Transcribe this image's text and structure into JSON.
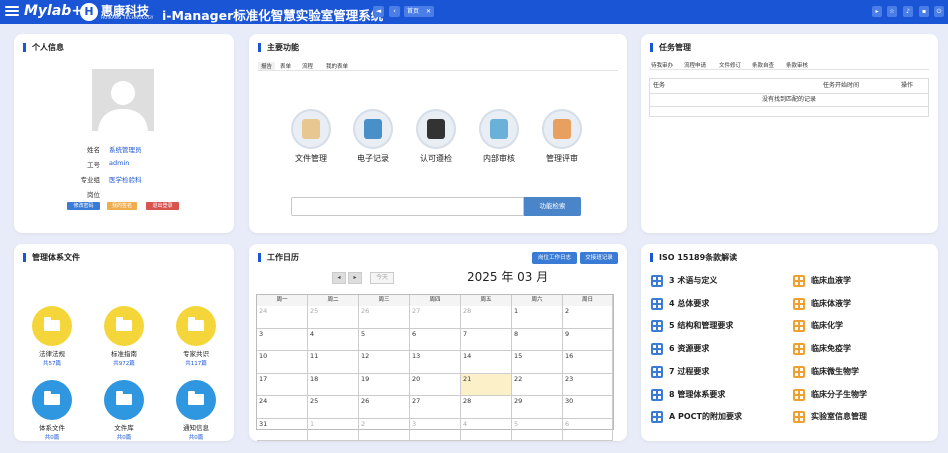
{
  "header": {
    "logo": "Mylab+",
    "company": "惠康科技",
    "company_en": "HUIKANG TECHNOLOGY",
    "system_title": "i-Manager标准化智慧实验室管理系统",
    "home_tab": "首页",
    "nav_prev": "◄",
    "nav_next": "‹",
    "tab_close": "✕"
  },
  "profile": {
    "title": "个人信息",
    "fields": [
      {
        "label": "姓名",
        "value": "系统管理员"
      },
      {
        "label": "工号",
        "value": "admin"
      },
      {
        "label": "专业组",
        "value": "医学检验科"
      },
      {
        "label": "岗位",
        "value": ""
      }
    ],
    "buttons": [
      "修改密码",
      "我的签名",
      "退出登录"
    ],
    "button_colors": [
      "#3a7bd5",
      "#f0ad4e",
      "#d9534f"
    ]
  },
  "functions": {
    "title": "主要功能",
    "tabs": [
      "报告",
      "表单",
      "流程",
      "我的表单"
    ],
    "items": [
      {
        "label": "文件管理",
        "icon": "document-management-icon"
      },
      {
        "label": "电子记录",
        "icon": "electronic-record-icon"
      },
      {
        "label": "认可遵检",
        "icon": "accreditation-icon"
      },
      {
        "label": "内部审核",
        "icon": "internal-audit-icon"
      },
      {
        "label": "管理评审",
        "icon": "management-review-icon"
      }
    ],
    "search_button": "功能检索",
    "search_value": ""
  },
  "tasks": {
    "title": "任务管理",
    "tabs": [
      "待我审办",
      "流程申请",
      "文件修订",
      "条款自查",
      "条款审核"
    ],
    "columns": [
      "任务",
      "任务开始时间",
      "操作"
    ],
    "empty_text": "没有找到匹配的记录"
  },
  "docs": {
    "title": "管理体系文件",
    "items": [
      {
        "name": "法律法规",
        "count": "共57篇",
        "color": "#f5d63a"
      },
      {
        "name": "标准指南",
        "count": "共972篇",
        "color": "#f5d63a"
      },
      {
        "name": "专家共识",
        "count": "共117篇",
        "color": "#f5d63a"
      },
      {
        "name": "体系文件",
        "count": "共0篇",
        "color": "#2f96e0"
      },
      {
        "name": "文件库",
        "count": "共0篇",
        "color": "#2f96e0"
      },
      {
        "name": "通知信息",
        "count": "共0篇",
        "color": "#2f96e0"
      }
    ]
  },
  "calendar": {
    "title": "工作日历",
    "buttons": [
      "岗位工作日志",
      "交接班记录"
    ],
    "today_button": "今天",
    "month_label": "2025 年 03 月",
    "weekdays": [
      "周一",
      "周二",
      "周三",
      "周四",
      "周五",
      "周六",
      "周日"
    ],
    "weeks": [
      [
        "24",
        "25",
        "26",
        "27",
        "28",
        "1",
        "2"
      ],
      [
        "3",
        "4",
        "5",
        "6",
        "7",
        "8",
        "9"
      ],
      [
        "10",
        "11",
        "12",
        "13",
        "14",
        "15",
        "16"
      ],
      [
        "17",
        "18",
        "19",
        "20",
        "21",
        "22",
        "23"
      ],
      [
        "24",
        "25",
        "26",
        "27",
        "28",
        "29",
        "30"
      ],
      [
        "31",
        "1",
        "2",
        "3",
        "4",
        "5",
        "6"
      ]
    ],
    "today": {
      "week": 3,
      "day": 4
    }
  },
  "iso": {
    "title": "ISO 15189条款解读",
    "left": [
      "3  术语与定义",
      "4  总体要求",
      "5  结构和管理要求",
      "6  资源要求",
      "7  过程要求",
      "8  管理体系要求",
      "A  POCT的附加要求"
    ],
    "right": [
      "临床血液学",
      "临床体液学",
      "临床化学",
      "临床免疫学",
      "临床微生物学",
      "临床分子生物学",
      "实验室信息管理"
    ],
    "left_color": "#3a7bd5",
    "right_color": "#f0a030"
  }
}
